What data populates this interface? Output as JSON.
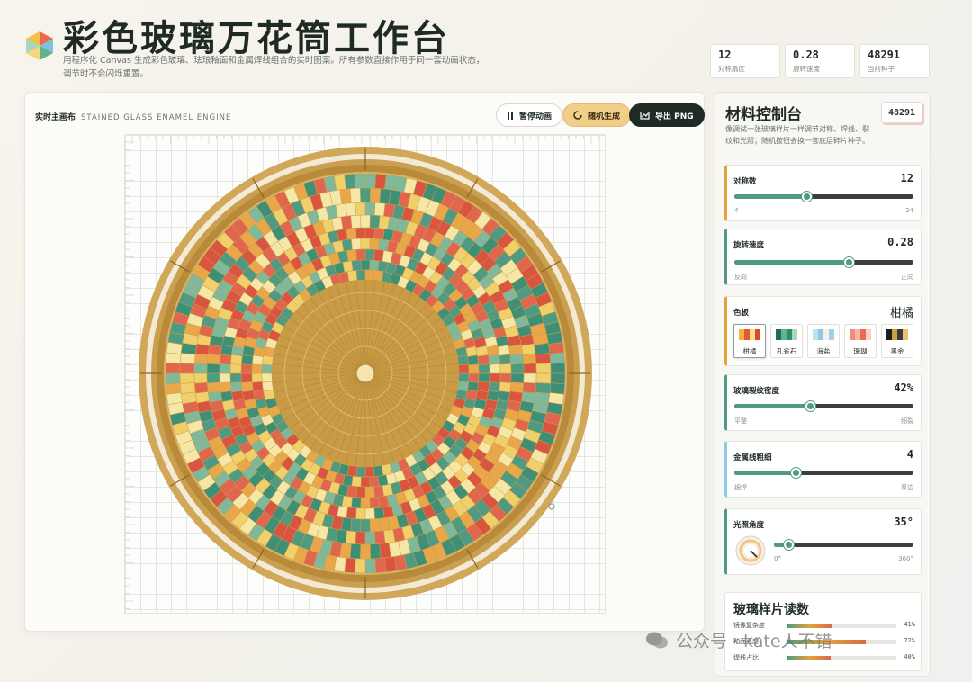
{
  "header": {
    "title": "彩色玻璃万花筒工作台",
    "subtitle": "用程序化 Canvas 生成彩色玻璃、珐琅釉面和金属焊线组合的实时图案。所有参数直接作用于同一套动画状态，调节时不会闪烁重置。"
  },
  "stats": [
    {
      "value": "12",
      "label": "对称扇区"
    },
    {
      "value": "0.28",
      "label": "旋转速度"
    },
    {
      "value": "48291",
      "label": "当前种子"
    }
  ],
  "canvas": {
    "label": "实时主画布",
    "engine": "STAINED GLASS ENAMEL ENGINE",
    "pause_label": "暂停动画",
    "random_label": "随机生成",
    "export_label": "导出 PNG"
  },
  "panel": {
    "title": "材料控制台",
    "seed": "48291",
    "description": "像调试一张玻璃样片一样调节对称、焊线、裂纹和光照；随机按钮会换一套底层碎片种子。"
  },
  "controls": {
    "symmetry": {
      "name": "对称数",
      "value": "12",
      "min": "4",
      "max": "24",
      "fraction": 0.4
    },
    "speed": {
      "name": "旋转速度",
      "value": "0.28",
      "min": "反向",
      "max": "正向",
      "fraction": 0.64
    },
    "palette": {
      "name": "色板",
      "value": "柑橘",
      "options": [
        {
          "label": "柑橘",
          "colors": [
            "#f2b340",
            "#e4553a",
            "#f5e08a",
            "#d9472f"
          ],
          "active": true
        },
        {
          "label": "孔雀石",
          "colors": [
            "#1f6e55",
            "#5fb38d",
            "#2f8f6d",
            "#a9d9bd"
          ],
          "active": false
        },
        {
          "label": "海盐",
          "colors": [
            "#bfe1ef",
            "#8ec9e3",
            "#f2f2ec",
            "#a3d0e6"
          ],
          "active": false
        },
        {
          "label": "珊瑚",
          "colors": [
            "#f28b7a",
            "#f6b79f",
            "#e86a5a",
            "#f9d3c4"
          ],
          "active": false
        },
        {
          "label": "黑金",
          "colors": [
            "#1f1f1f",
            "#c9a046",
            "#3a3a3a",
            "#e6c46e"
          ],
          "active": false
        }
      ]
    },
    "crack": {
      "name": "玻璃裂纹密度",
      "value": "42%",
      "min": "平整",
      "max": "细裂",
      "fraction": 0.42
    },
    "wire": {
      "name": "金属线粗细",
      "value": "4",
      "min": "细焊",
      "max": "厚边",
      "fraction": 0.34
    },
    "light": {
      "name": "光照角度",
      "value": "35°",
      "min": "0°",
      "max": "360°",
      "fraction": 0.1
    }
  },
  "readout": {
    "title": "玻璃样片读数",
    "rows": [
      {
        "label": "镜像复杂度",
        "value": "41%",
        "fraction": 0.41
      },
      {
        "label": "釉面亮度",
        "value": "72%",
        "fraction": 0.72
      },
      {
        "label": "焊线占比",
        "value": "40%",
        "fraction": 0.4
      }
    ]
  },
  "watermark": "公众号 · kate人不错",
  "colors": {
    "accent_teal": "#4f9a80",
    "accent_orange": "#e3a23a",
    "gold": "#d1a85a",
    "dark": "#1f2a25"
  }
}
